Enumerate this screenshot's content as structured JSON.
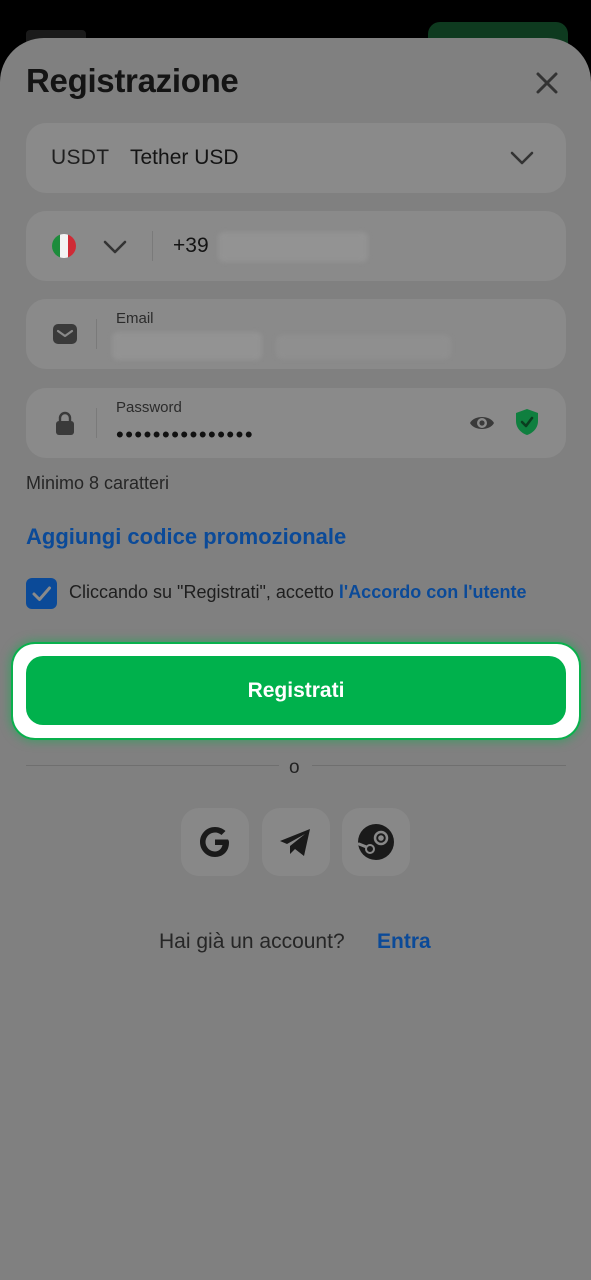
{
  "sheet": {
    "title": "Registrazione"
  },
  "currency": {
    "code": "USDT",
    "name": "Tether USD"
  },
  "phone": {
    "prefix": "+39"
  },
  "email": {
    "label": "Email"
  },
  "password": {
    "label": "Password",
    "masked_value": "•••••••••••••••",
    "hint": "Minimo 8 caratteri"
  },
  "promo": {
    "label": "Aggiungi codice promozionale"
  },
  "agreement": {
    "text": "Cliccando su \"Registrati\", accetto ",
    "link": "l'Accordo con l'utente",
    "checked": true
  },
  "cta": {
    "label": "Registrati"
  },
  "divider": {
    "text": "o"
  },
  "social": [
    "google-icon",
    "telegram-icon",
    "steam-icon"
  ],
  "login": {
    "question": "Hai già un account?",
    "link": "Entra"
  },
  "colors": {
    "accent_green": "#00b14c",
    "link_blue": "#0b4a98",
    "overlay_gray": "#808080"
  }
}
